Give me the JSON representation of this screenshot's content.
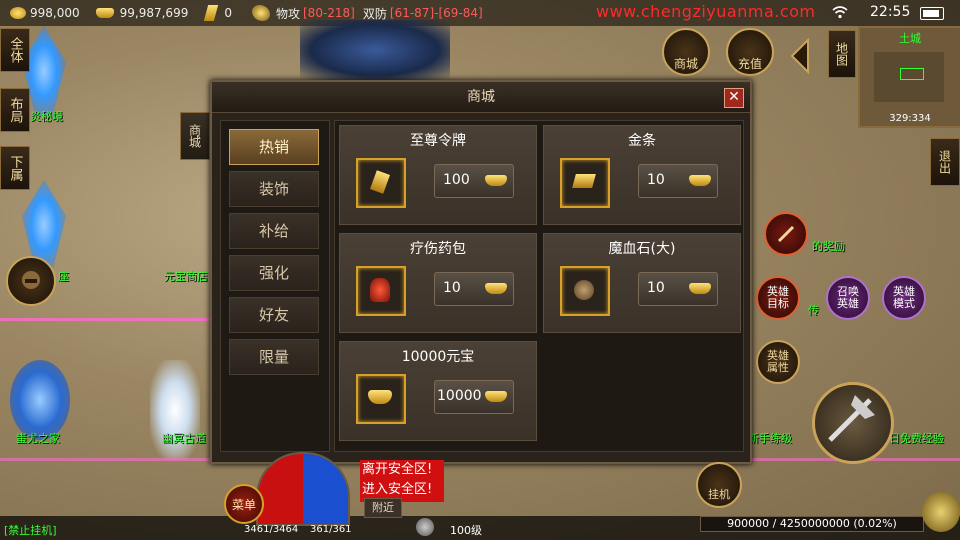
{
  "status": {
    "gold": "998,000",
    "ingots": "99,987,699",
    "bars": "0",
    "attack_label": "物攻",
    "attack_value": "[80-218]",
    "defense_label": "双防",
    "defense_value": "[61-87]-[69-84]",
    "url": "www.chengziyuanma.com",
    "time": "22:55"
  },
  "left_buttons": [
    "全体",
    "布局",
    "下属"
  ],
  "top_icons": [
    "商城",
    "充值"
  ],
  "minimap": {
    "map_name": "土城",
    "button": "地图",
    "coords": "329:334"
  },
  "exit_button": "退出",
  "scene_labels": {
    "label1": "炎秘境",
    "label2": "座",
    "label3": "元宝商店",
    "label4": "蚩尤之家",
    "label5": "幽冥古道",
    "label6": "新手练级",
    "label7": "每日免费经验",
    "label8": "的奖励",
    "label9": "传"
  },
  "hero_buttons": {
    "hero_target": "英雄目标",
    "summon_hero": "召唤英雄",
    "hero_mode": "英雄模式",
    "hero_attr": "英雄属性"
  },
  "shop": {
    "title": "商城",
    "side_tab": "商城",
    "categories": [
      "热销",
      "装饰",
      "补给",
      "强化",
      "好友",
      "限量"
    ],
    "active_category": "热销",
    "items": [
      {
        "name": "至尊令牌",
        "icon": "token-icon",
        "price": "100"
      },
      {
        "name": "金条",
        "icon": "gold-bar-icon",
        "price": "10"
      },
      {
        "name": "疗伤药包",
        "icon": "potion-icon",
        "price": "10"
      },
      {
        "name": "魔血石(大)",
        "icon": "blood-stone-icon",
        "price": "10"
      },
      {
        "name": "10000元宝",
        "icon": "ingot-icon",
        "price": "10000"
      }
    ]
  },
  "hud": {
    "menu": "菜单",
    "hp": "3461/3464",
    "mp": "361/361",
    "level": "100级",
    "safe_zone_leave": "离开安全区!",
    "safe_zone_enter": "进入安全区!",
    "nearby": "附近",
    "hangup": "挂机",
    "exp": "900000 / 4250000000 (0.02%)",
    "no_hangup": "[禁止挂机]"
  }
}
